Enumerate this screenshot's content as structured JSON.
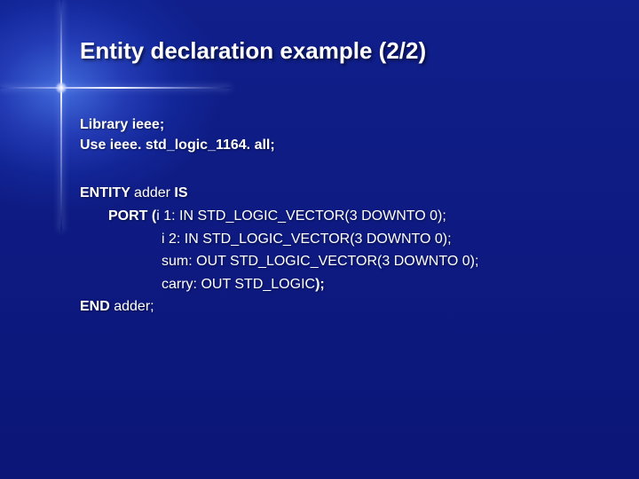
{
  "title": "Entity declaration example (2/2)",
  "lib1": "Library ieee;",
  "lib2": "Use ieee. std_logic_1164. all;",
  "code": {
    "l1a": "ENTITY ",
    "l1b": "adder ",
    "l1c": "IS",
    "l2a": "PORT (",
    "l2b": "i 1: IN STD_LOGIC_VECTOR(3 DOWNTO 0);",
    "l3": "i 2: IN STD_LOGIC_VECTOR(3 DOWNTO 0);",
    "l4": "sum: OUT STD_LOGIC_VECTOR(3 DOWNTO 0);",
    "l5a": "carry: OUT STD_LOGIC",
    "l5b": ");",
    "l6a": "END ",
    "l6b": "adder;"
  }
}
